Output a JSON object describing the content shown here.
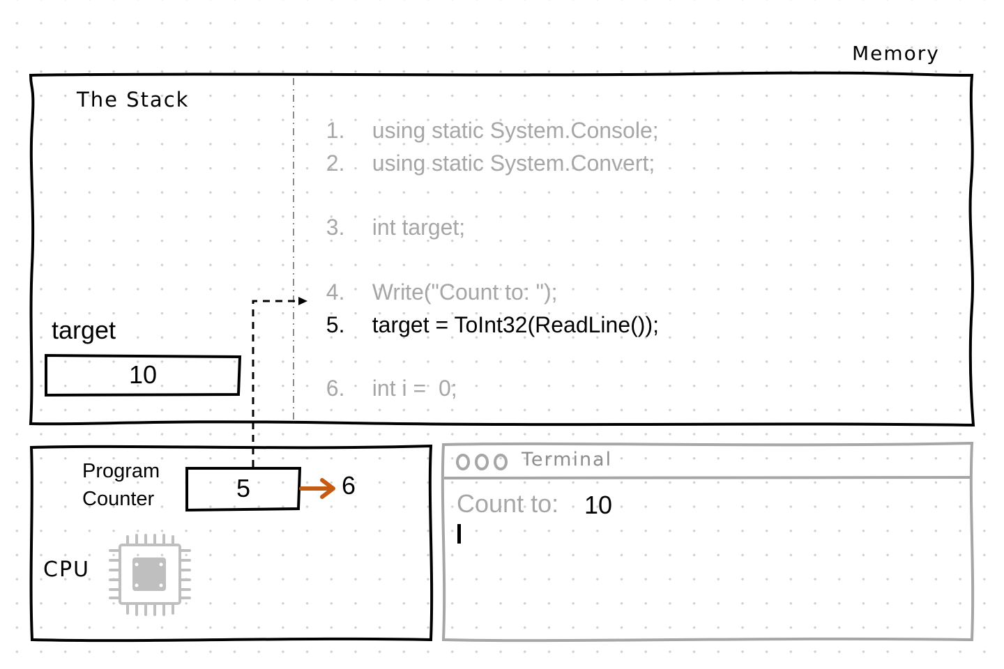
{
  "diagram": {
    "title": "Memory",
    "stack": {
      "title": "The Stack",
      "variables": [
        {
          "name": "target",
          "value": "10"
        }
      ]
    },
    "code": {
      "current_line": 5,
      "lines": [
        {
          "number": "1.",
          "text": "using static System.Console;",
          "active": false
        },
        {
          "number": "2.",
          "text": "using static System.Convert;",
          "active": false
        },
        {
          "number": "3.",
          "text": "int target;",
          "active": false
        },
        {
          "number": "4.",
          "text": "Write(\"Count to: \");",
          "active": false
        },
        {
          "number": "5.",
          "text": "target = ToInt32(ReadLine());",
          "active": true
        },
        {
          "number": "6.",
          "text": "int i =  0;",
          "active": false
        }
      ]
    },
    "cpu": {
      "label": "CPU",
      "program_counter": {
        "label_line1": "Program",
        "label_line2": "Counter",
        "value": "5",
        "next_value": "6"
      }
    },
    "terminal": {
      "window_buttons": "OOO",
      "title": "Terminal",
      "prompt": "Count to:",
      "input": "10"
    },
    "colors": {
      "ink": "#000000",
      "muted": "#a6a6a6",
      "terminal_frame": "#a6a6a6",
      "arrow_accent": "#c55a11",
      "chip": "#bfbfbf"
    },
    "icons": {
      "cpu_chip": "cpu-chip-icon",
      "increment_arrow": "arrow-right-icon",
      "pointer_arrow": "dashed-arrow-icon"
    }
  }
}
